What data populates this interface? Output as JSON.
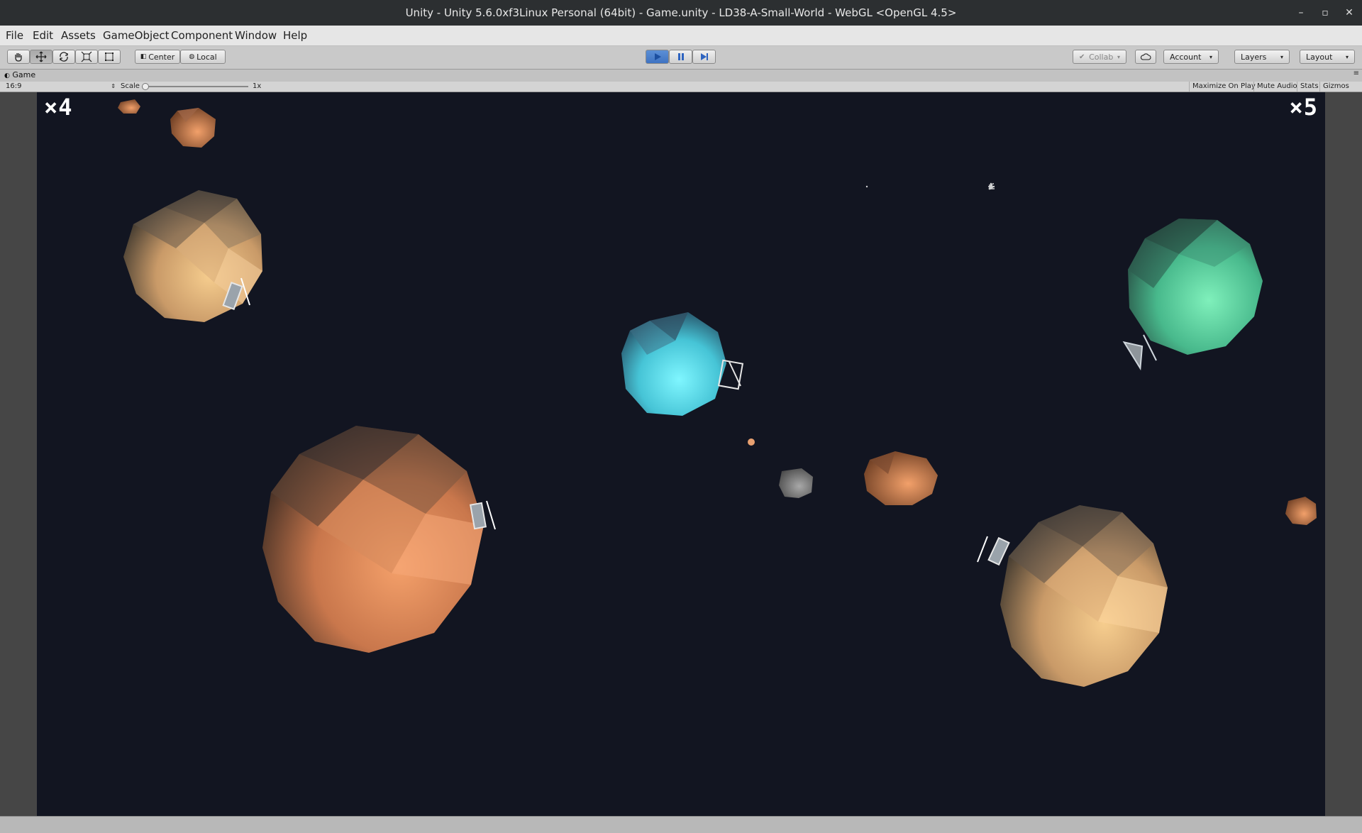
{
  "window": {
    "title": "Unity - Unity 5.6.0xf3Linux Personal (64bit) - Game.unity - LD38-A-Small-World - WebGL <OpenGL 4.5>",
    "minimize_glyph": "–",
    "maximize_glyph": "▫",
    "close_glyph": "✕"
  },
  "menu": [
    "File",
    "Edit",
    "Assets",
    "GameObject",
    "Component",
    "Window",
    "Help"
  ],
  "toolbar": {
    "pivot_label": "Center",
    "space_label": "Local",
    "collab_label": "Collab",
    "account_label": "Account",
    "layers_label": "Layers",
    "layout_label": "Layout"
  },
  "game_view": {
    "tab_label": "Game",
    "aspect": "16:9",
    "scale_label": "Scale",
    "scale_value": "1x",
    "maximize_label": "Maximize On Play",
    "mute_label": "Mute Audio",
    "stats_label": "Stats",
    "gizmos_label": "Gizmos"
  },
  "hud": {
    "left_score": "×4",
    "right_score": "×5"
  },
  "colors": {
    "space": "#121521",
    "planet_orange": "#e08a58",
    "planet_tan": "#e6b680",
    "planet_green": "#67d8a6",
    "planet_cyan": "#63dce8",
    "play_button": "#4a7fcf"
  }
}
